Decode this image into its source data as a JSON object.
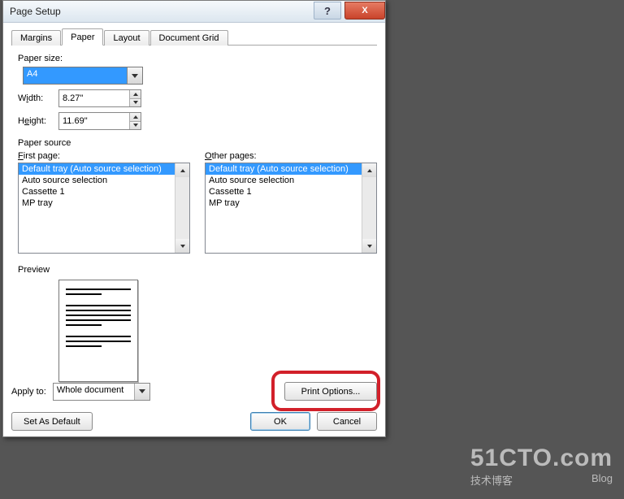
{
  "title": "Page Setup",
  "tabs": {
    "margins": "Margins",
    "paper": "Paper",
    "layout": "Layout",
    "grid": "Document Grid"
  },
  "paperSize": {
    "label": "Paper size:",
    "selected": "A4",
    "widthLabelPre": "W",
    "widthLabelU": "i",
    "widthLabelPost": "dth:",
    "heightLabelPre": "H",
    "heightLabelU": "e",
    "heightLabelPost": "ight:",
    "width": "8.27\"",
    "height": "11.69\""
  },
  "paperSource": {
    "group": "Paper source",
    "firstPre": "F",
    "firstU": "i",
    "firstPost": "rst page:",
    "otherPre": "O",
    "otherU": "t",
    "otherPost": "her pages:",
    "items": {
      "a": "Default tray (Auto source selection)",
      "b": "Auto source selection",
      "c": "Cassette 1",
      "d": "MP tray"
    }
  },
  "preview": "Preview",
  "applyTo": {
    "label": "Apply to:",
    "value": "Whole document"
  },
  "buttons": {
    "printOptions": "Print Options...",
    "setDefault": "Set As Default",
    "ok": "OK",
    "cancel": "Cancel",
    "help": "?",
    "close": "X"
  },
  "watermark": {
    "big": "51CTO.com",
    "small1": "技术博客",
    "small2": "Blog"
  }
}
